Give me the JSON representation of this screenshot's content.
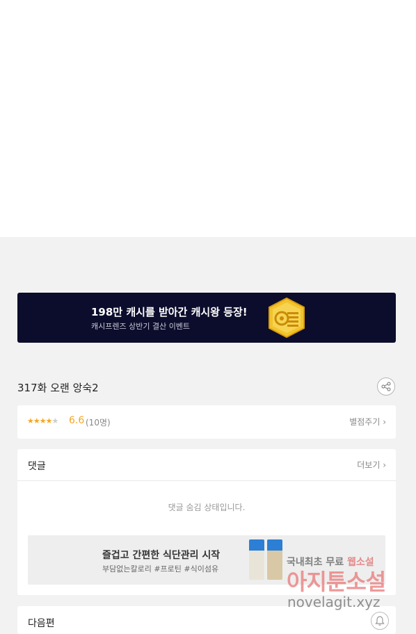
{
  "banner": {
    "title": "198만 캐시를 받아간 캐시왕 등장!",
    "subtitle": "캐시프렌즈 상반기 결산 이벤트"
  },
  "episode": {
    "title": "317화 오랜 앙숙2"
  },
  "rating": {
    "stars_filled": "★★★★",
    "stars_empty": "★",
    "score": "6.6",
    "count": "(10명)",
    "rate_link": "별점주기 ›"
  },
  "comments": {
    "title": "댓글",
    "more": "더보기 ›",
    "hidden_message": "댓글 숨김 상태입니다."
  },
  "ad": {
    "title": "즐겁고 간편한 식단관리 시작",
    "subtitle": "부담없는칼로리 #프로틴 #식이섬유"
  },
  "next": {
    "title": "다음편"
  },
  "watermark": {
    "line1_prefix": "국내최초 무료 ",
    "line1_highlight": "웹소설",
    "line2": "아지툰소설",
    "line3": "novelagit.xyz"
  },
  "colors": {
    "accent_star": "#f5a623",
    "banner_bg": "#0c0d2c"
  }
}
